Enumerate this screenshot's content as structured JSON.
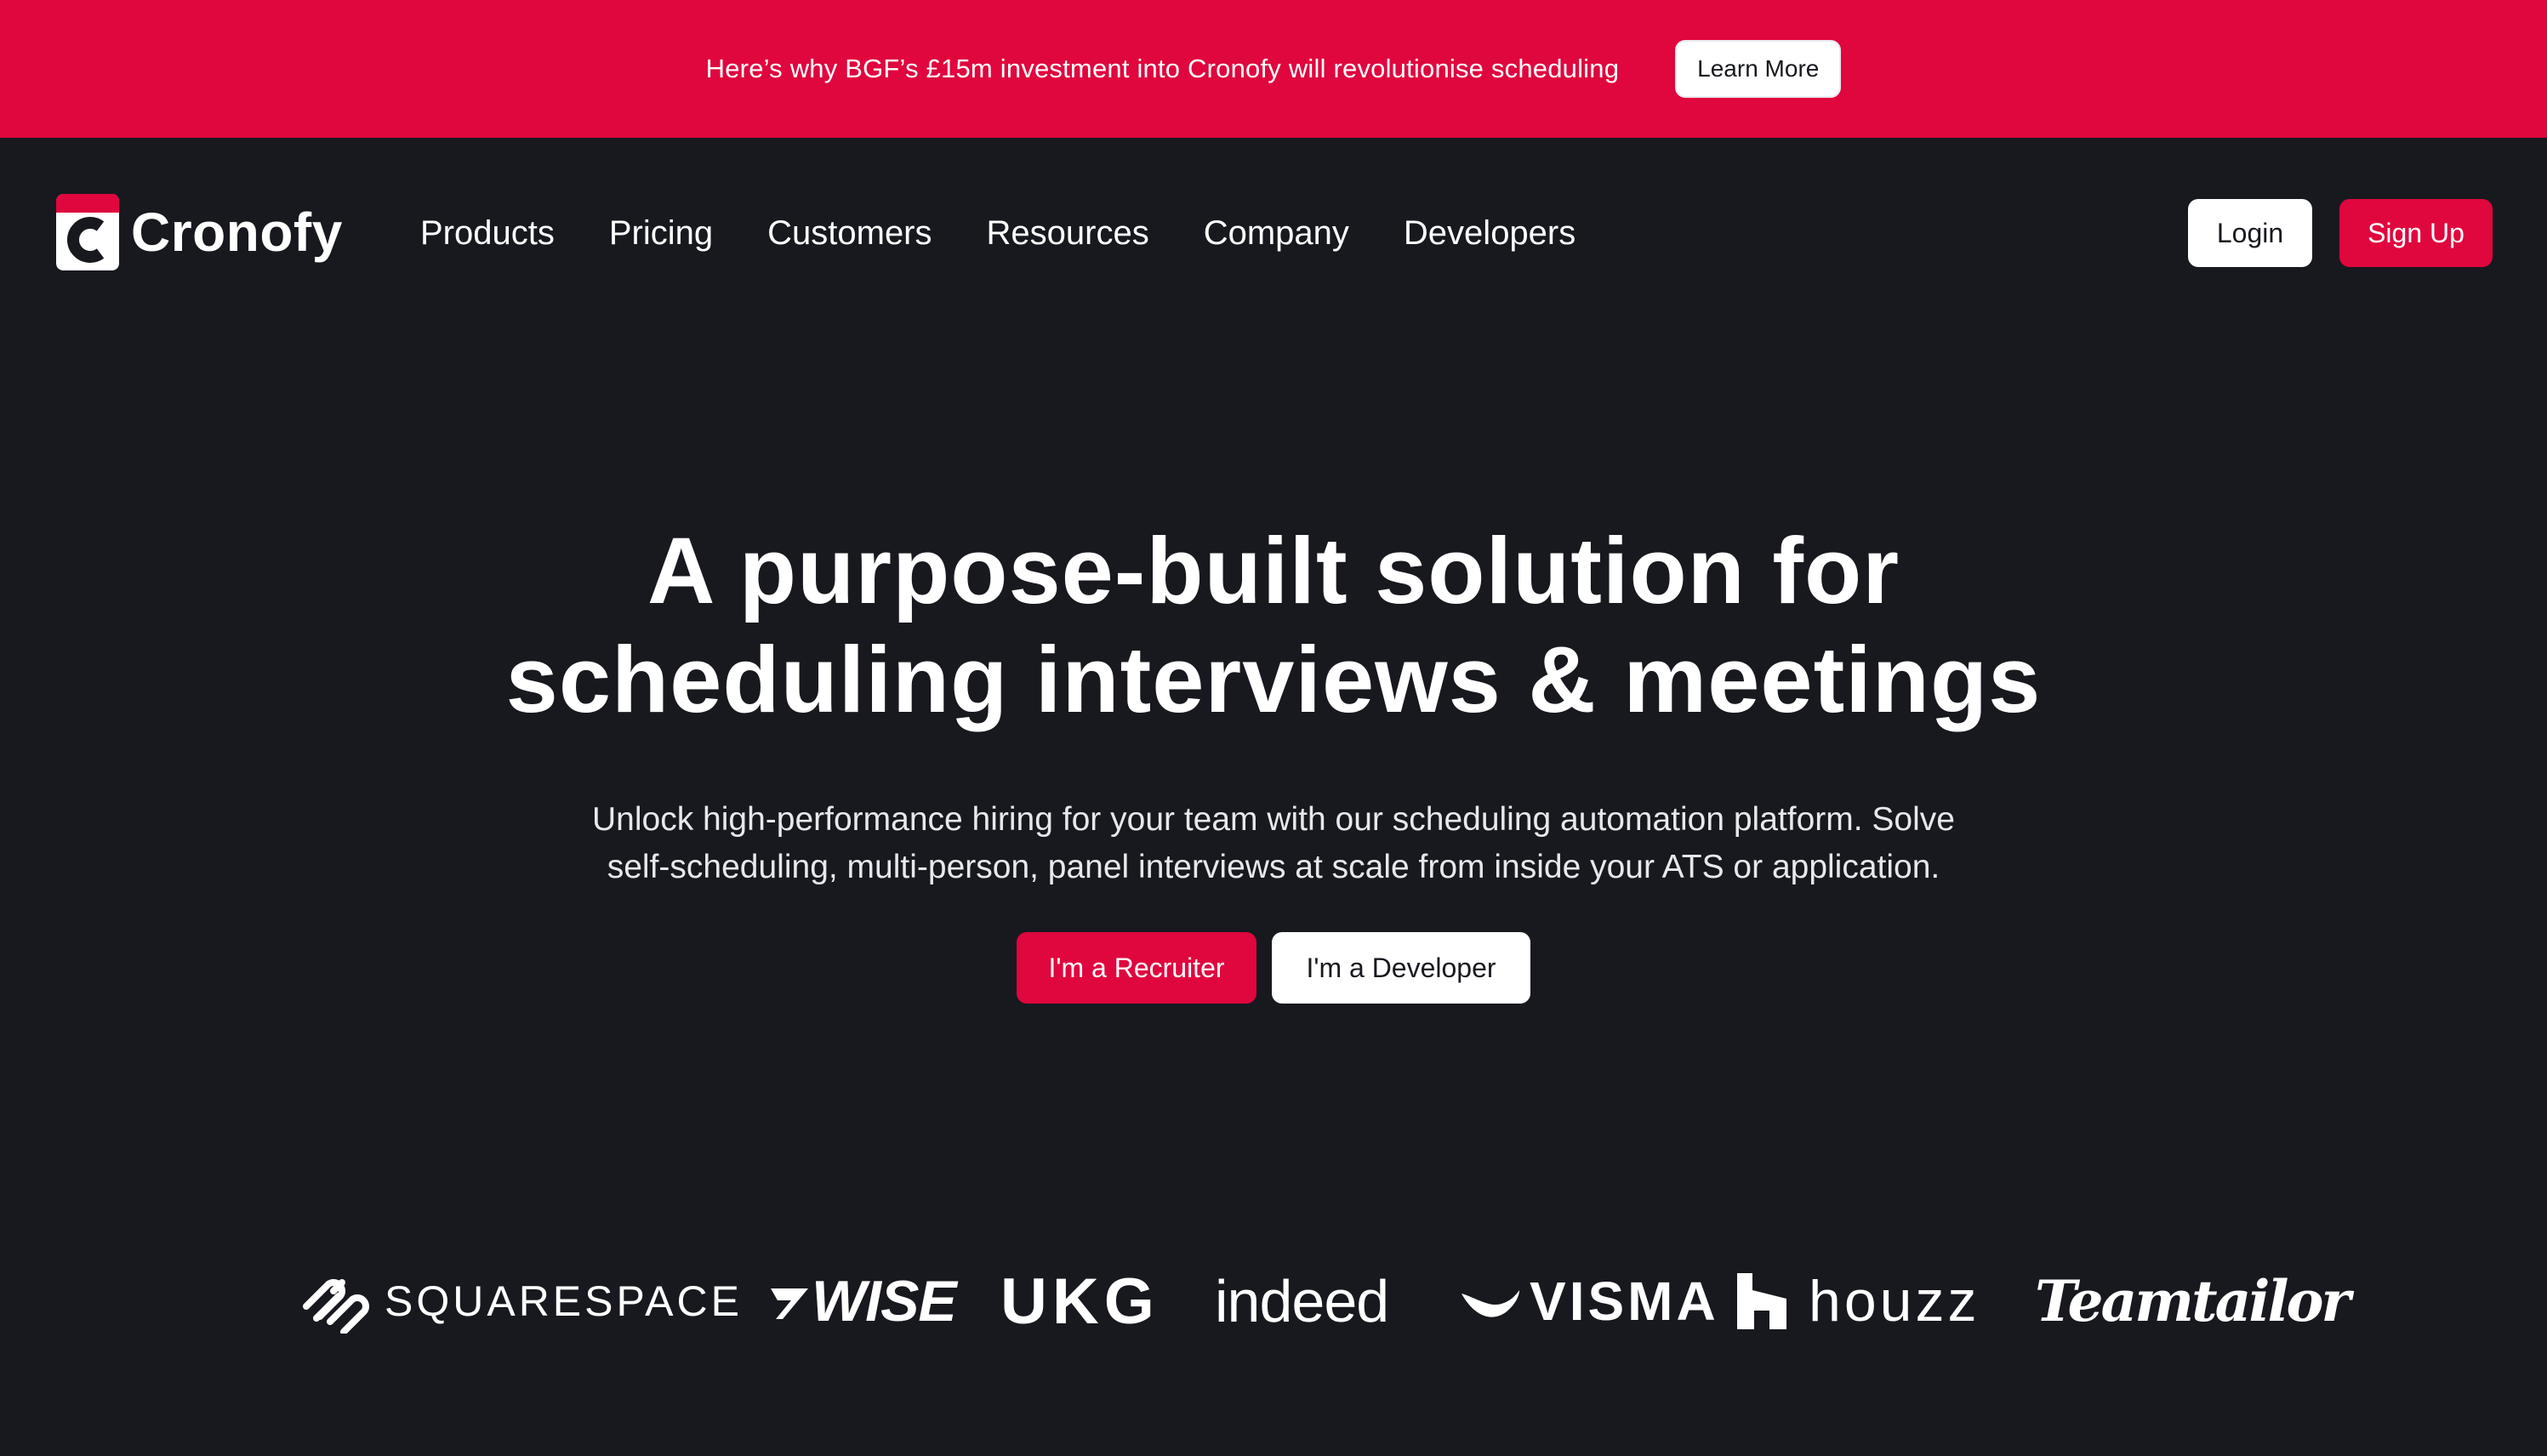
{
  "announcement": {
    "text": "Here’s why BGF’s £15m investment into Cronofy will revolutionise scheduling",
    "button_label": "Learn More"
  },
  "nav": {
    "brand_name": "Cronofy",
    "links": [
      {
        "label": "Products"
      },
      {
        "label": "Pricing"
      },
      {
        "label": "Customers"
      },
      {
        "label": "Resources"
      },
      {
        "label": "Company"
      },
      {
        "label": "Developers"
      }
    ],
    "login_label": "Login",
    "signup_label": "Sign Up"
  },
  "hero": {
    "title_line1": "A purpose-built solution for",
    "title_line2": "scheduling interviews & meetings",
    "subtitle_line1": "Unlock high-performance hiring for your team with our scheduling automation platform. Solve",
    "subtitle_line2": "self-scheduling, multi-person, panel interviews at scale from inside your ATS or application.",
    "cta_recruiter": "I'm a Recruiter",
    "cta_developer": "I'm a Developer"
  },
  "customer_logos": {
    "squarespace": "SQUARESPACE",
    "wise": "WISE",
    "ukg": "UKG",
    "indeed": "indeed",
    "visma": "VISMA",
    "houzz": "houzz",
    "teamtailor": "Teamtailor"
  },
  "colors": {
    "accent": "#e0063e",
    "background": "#17191f",
    "text": "#ffffff"
  }
}
